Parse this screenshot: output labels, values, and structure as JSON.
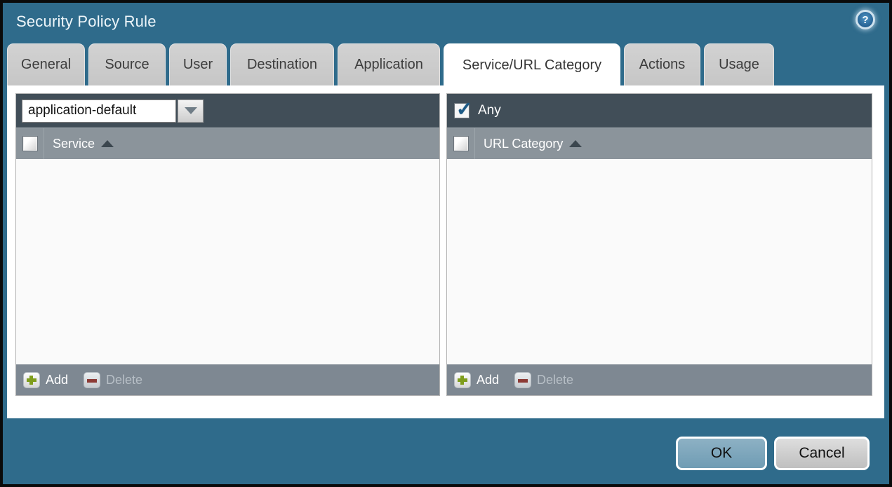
{
  "dialog": {
    "title": "Security Policy Rule",
    "help_icon_glyph": "?"
  },
  "tabs": [
    {
      "label": "General",
      "active": false
    },
    {
      "label": "Source",
      "active": false
    },
    {
      "label": "User",
      "active": false
    },
    {
      "label": "Destination",
      "active": false
    },
    {
      "label": "Application",
      "active": false
    },
    {
      "label": "Service/URL Category",
      "active": true
    },
    {
      "label": "Actions",
      "active": false
    },
    {
      "label": "Usage",
      "active": false
    }
  ],
  "service_panel": {
    "dropdown_value": "application-default",
    "header_checkbox_checked": false,
    "column_header": "Service",
    "sort_direction": "asc",
    "rows": [],
    "add_label": "Add",
    "delete_label": "Delete",
    "delete_enabled": false
  },
  "url_category_panel": {
    "any_label": "Any",
    "any_checked": true,
    "header_checkbox_checked": false,
    "column_header": "URL Category",
    "sort_direction": "asc",
    "rows": [],
    "add_label": "Add",
    "delete_label": "Delete",
    "delete_enabled": false
  },
  "footer": {
    "ok_label": "OK",
    "cancel_label": "Cancel"
  },
  "colors": {
    "dialog_background": "#2f6b8b",
    "outer_border": "#0a0a0a",
    "inactive_tab": "#c9c9c9",
    "active_tab": "#ffffff",
    "panel_toolbar": "#414e58",
    "panel_header": "#8b949b",
    "panel_body": "#fafafa",
    "panel_footer": "#7e8892",
    "ok_button": "#7aa5bb",
    "cancel_button": "#cccccc",
    "add_icon_green": "#7f9d1c",
    "delete_icon_red": "#8c3a35",
    "check_blue": "#1d5a85"
  }
}
